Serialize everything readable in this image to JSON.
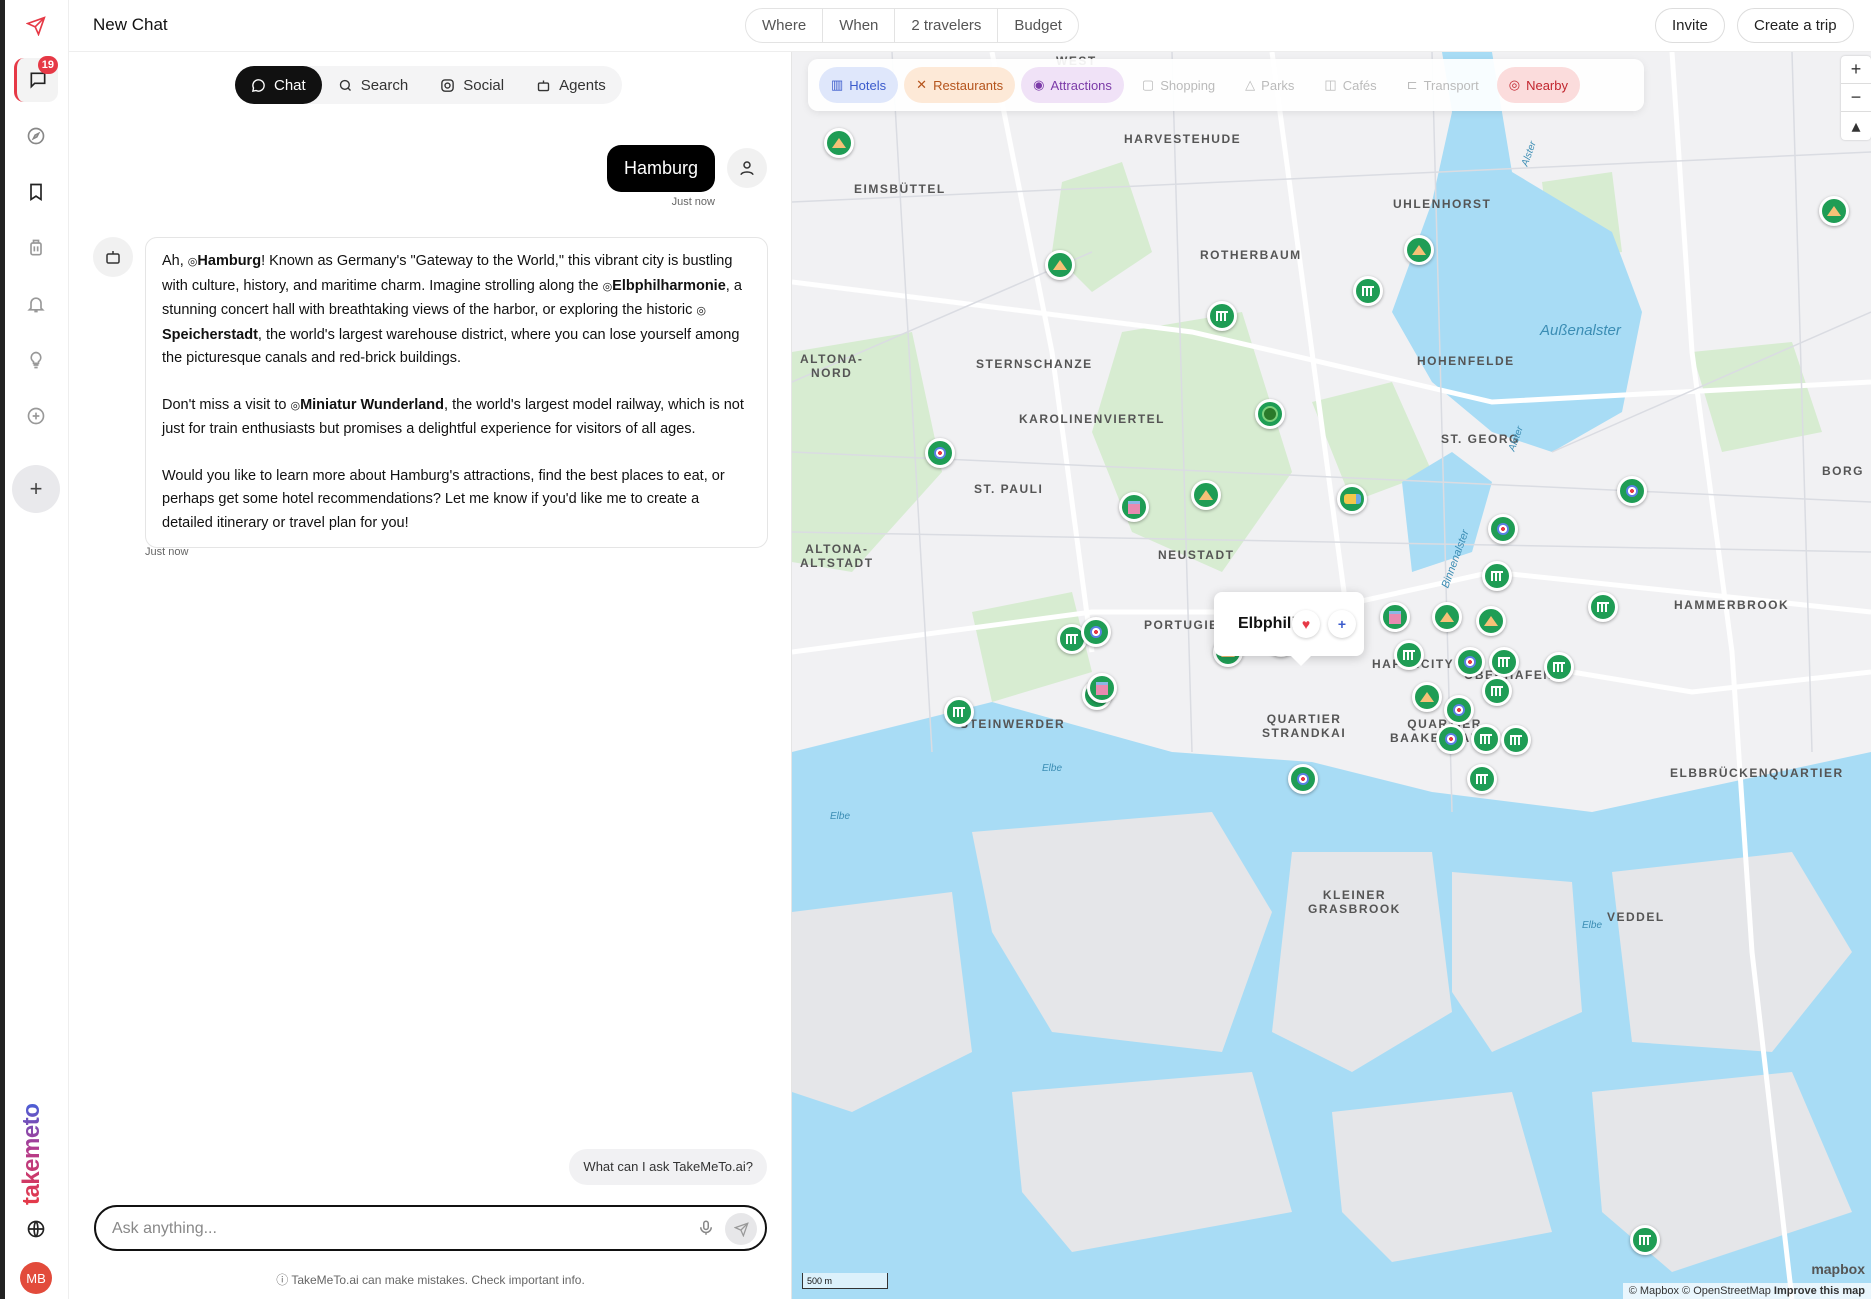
{
  "header": {
    "title": "New Chat",
    "filters": [
      "Where",
      "When",
      "2 travelers",
      "Budget"
    ],
    "invite_label": "Invite",
    "create_trip_label": "Create a trip"
  },
  "rail": {
    "chat_badge": "19",
    "logo_text": "takemeto",
    "avatar_initials": "MB"
  },
  "chat": {
    "modes": [
      "Chat",
      "Search",
      "Social",
      "Agents"
    ],
    "user_message": "Hamburg",
    "user_time": "Just now",
    "bot_paragraphs": [
      [
        {
          "t": "Ah, "
        },
        {
          "pin": true,
          "b": "Hamburg"
        },
        {
          "t": "! Known as Germany's \"Gateway to the World,\" this vibrant city is bustling with culture, history, and maritime charm. Imagine strolling along the "
        },
        {
          "pin": true,
          "b": "Elbphilharmonie"
        },
        {
          "t": ", a stunning concert hall with breathtaking views of the harbor, or exploring the historic "
        },
        {
          "pin": true,
          "b": "Speicherstadt"
        },
        {
          "t": ", the world's largest warehouse district, where you can lose yourself among the picturesque canals and red-brick buildings."
        }
      ],
      [
        {
          "t": "Don't miss a visit to "
        },
        {
          "pin": true,
          "b": "Miniatur Wunderland"
        },
        {
          "t": ", the world's largest model railway, which is not just for train enthusiasts but promises a delightful experience for visitors of all ages."
        }
      ],
      [
        {
          "t": "Would you like to learn more about Hamburg's attractions, find the best places to eat, or perhaps get some hotel recommendations? Let me know if you'd like me to create a detailed itinerary or travel plan for you!"
        }
      ]
    ],
    "bot_time": "Just now",
    "suggestion": "What can I ask TakeMeTo.ai?",
    "input_placeholder": "Ask anything...",
    "disclaimer": "TakeMeTo.ai can make mistakes. Check important info."
  },
  "map": {
    "categories": [
      {
        "label": "Hotels",
        "bg": "#dfe7fb",
        "fg": "#3b5bcc",
        "icon": "hotel-icon",
        "state": "active"
      },
      {
        "label": "Restaurants",
        "bg": "#fde9d7",
        "fg": "#b5541c",
        "icon": "cutlery-icon",
        "state": "active"
      },
      {
        "label": "Attractions",
        "bg": "#f0e2f7",
        "fg": "#7b3aa8",
        "icon": "camera-icon",
        "state": "active"
      },
      {
        "label": "Shopping",
        "bg": "transparent",
        "fg": "#bbbbbb",
        "icon": "bag-icon",
        "state": "inactive"
      },
      {
        "label": "Parks",
        "bg": "transparent",
        "fg": "#bbbbbb",
        "icon": "tree-icon",
        "state": "inactive"
      },
      {
        "label": "Cafés",
        "bg": "transparent",
        "fg": "#bbbbbb",
        "icon": "cup-icon",
        "state": "inactive"
      },
      {
        "label": "Transport",
        "bg": "transparent",
        "fg": "#bbbbbb",
        "icon": "car-icon",
        "state": "inactive"
      },
      {
        "label": "Nearby",
        "bg": "#fbdcdc",
        "fg": "#c2262f",
        "icon": "pin-icon",
        "state": "active"
      }
    ],
    "place_labels": [
      "WEST",
      "HARVESTEHUDE",
      "EIMSBÜTTEL",
      "ROTHERBAUM",
      "UHLENHORST",
      "ALTONA-\nNORD",
      "STERNSCHANZE",
      "HOHENFELDE",
      "KAROLINENVIERTEL",
      "ST. PAULI",
      "ST. GEORG",
      "BORG",
      "ALTONA-\nALTSTADT",
      "NEUSTADT",
      "HAMMERBROOK",
      "PORTUGIESEN",
      "HAFENCITY",
      "OBERHAFEN",
      "STEINWERDER",
      "QUARTIER\nSTRANDKAI",
      "QUARTIER\nBAAKENHAFEN",
      "ELBBRÜCKENQUARTIER",
      "KLEINER\nGRASBROOK",
      "VEDDEL"
    ],
    "water_labels": [
      "Außenalster",
      "Alster",
      "Alster",
      "Binnenalster",
      "Elbe",
      "Elbe",
      "Elbe"
    ],
    "popup_title": "Elbphil",
    "popup_title_tail": "ie",
    "scale_label": "500 m",
    "attribution": "© Mapbox © OpenStreetMap",
    "improve_label": "Improve this map",
    "mapbox_label": "mapbox",
    "colors": {
      "marker": "#1f9d55",
      "accent": "#e63946"
    }
  }
}
